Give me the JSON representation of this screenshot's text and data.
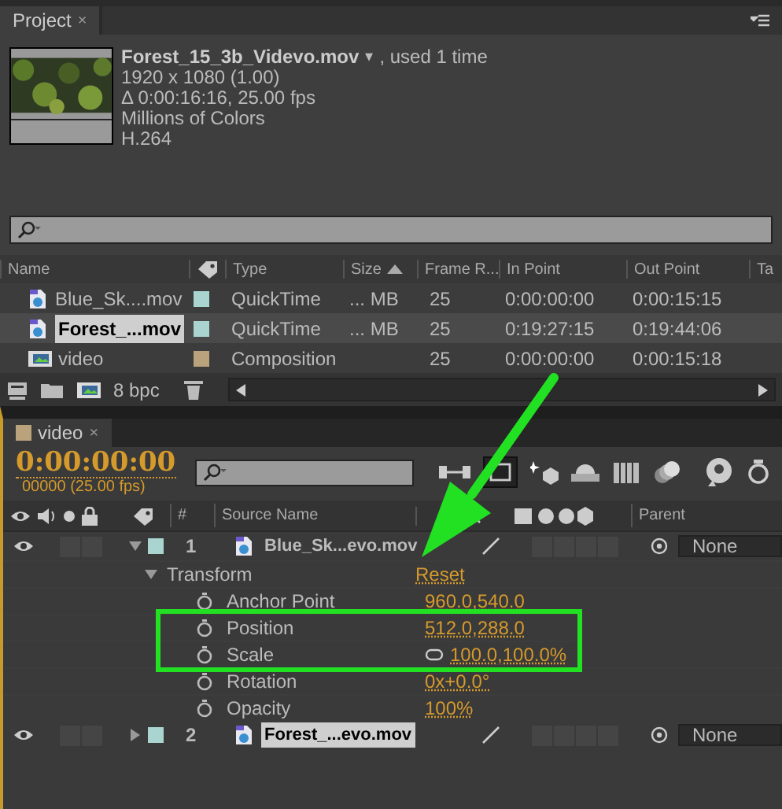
{
  "project_panel": {
    "tab": "Project",
    "close": "×",
    "info": {
      "name": "Forest_15_3b_Videvo.mov",
      "caret": "▾",
      "usage": ", used 1 time",
      "lines": [
        "1920 x 1080 (1.00)",
        "Δ 0:00:16:16, 25.00 fps",
        "Millions of Colors",
        "H.264"
      ]
    },
    "columns": [
      "Name",
      "Type",
      "Size",
      "Frame R...",
      "In Point",
      "Out Point",
      "Ta"
    ],
    "items": [
      {
        "kind": "footage",
        "name": "Blue_Sk....mov",
        "color": "#a9d4d0",
        "type": "QuickTime",
        "size": "... MB",
        "frame_rate": "25",
        "in_point": "0:00:00:00",
        "out_point": "0:00:15:15",
        "selected": false
      },
      {
        "kind": "footage",
        "name": "Forest_...mov",
        "color": "#a9d4d0",
        "type": "QuickTime",
        "size": "... MB",
        "frame_rate": "25",
        "in_point": "0:19:27:15",
        "out_point": "0:19:44:06",
        "selected": true
      },
      {
        "kind": "composition",
        "name": "video",
        "color": "#b9a27c",
        "type": "Composition",
        "frame_rate": "25",
        "in_point": "0:00:00:00",
        "out_point": "0:00:15:18",
        "selected": false
      }
    ],
    "bpc": "8 bpc"
  },
  "timeline": {
    "tab": {
      "label": "video",
      "color": "#b9a27c"
    },
    "close": "×",
    "timecode": "0:00:00:00",
    "frame_info": "00000 (25.00 fps)",
    "columns": [
      "#",
      "Source Name",
      "Parent"
    ],
    "layers": [
      {
        "number": "1",
        "name": "Blue_Sk...evo.mov",
        "color": "#a9d4d0",
        "expanded": true,
        "selected": false,
        "solo": false,
        "locked": false,
        "switches": [
          false,
          false,
          false,
          false
        ],
        "parent": "None",
        "transform": {
          "label": "Transform",
          "reset": "Reset",
          "properties": [
            {
              "name": "Anchor Point",
              "value": "960.0,540.0",
              "linked": false,
              "highlighted": false
            },
            {
              "name": "Position",
              "value": "512.0,288.0",
              "linked": false,
              "highlighted": true
            },
            {
              "name": "Scale",
              "value": "100.0,100.0%",
              "linked": true,
              "highlighted": true
            },
            {
              "name": "Rotation",
              "value": "0x+0.0°",
              "linked": false,
              "highlighted": false
            },
            {
              "name": "Opacity",
              "value": "100%",
              "linked": false,
              "highlighted": false
            }
          ]
        }
      },
      {
        "number": "2",
        "name": "Forest_...evo.mov",
        "color": "#a9d4d0",
        "expanded": false,
        "selected": true,
        "solo": false,
        "locked": false,
        "switches": [
          false,
          false,
          false,
          false
        ],
        "parent": "None"
      }
    ]
  }
}
